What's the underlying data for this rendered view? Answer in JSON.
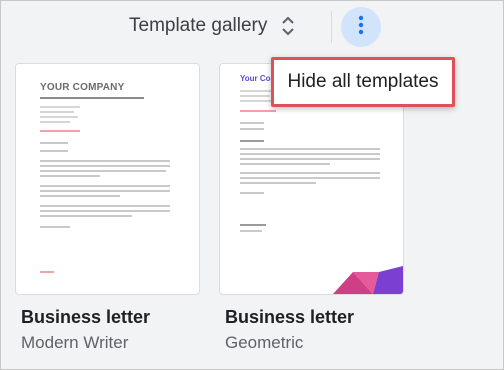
{
  "toolbar": {
    "gallery_label": "Template gallery",
    "gallery_toggle_icon": "unfold-more-icon",
    "more_icon": "more-vert-icon"
  },
  "menu": {
    "items": [
      {
        "label": "Hide all templates"
      }
    ]
  },
  "templates": [
    {
      "title": "Business letter",
      "subtitle": "Modern Writer",
      "preview_heading": "YOUR COMPANY"
    },
    {
      "title": "Business letter",
      "subtitle": "Geometric",
      "preview_heading": "Your Comp"
    }
  ],
  "colors": {
    "accent": "#1a73e8",
    "menu_highlight_border": "#e0505a",
    "background": "#f1f3f4"
  }
}
